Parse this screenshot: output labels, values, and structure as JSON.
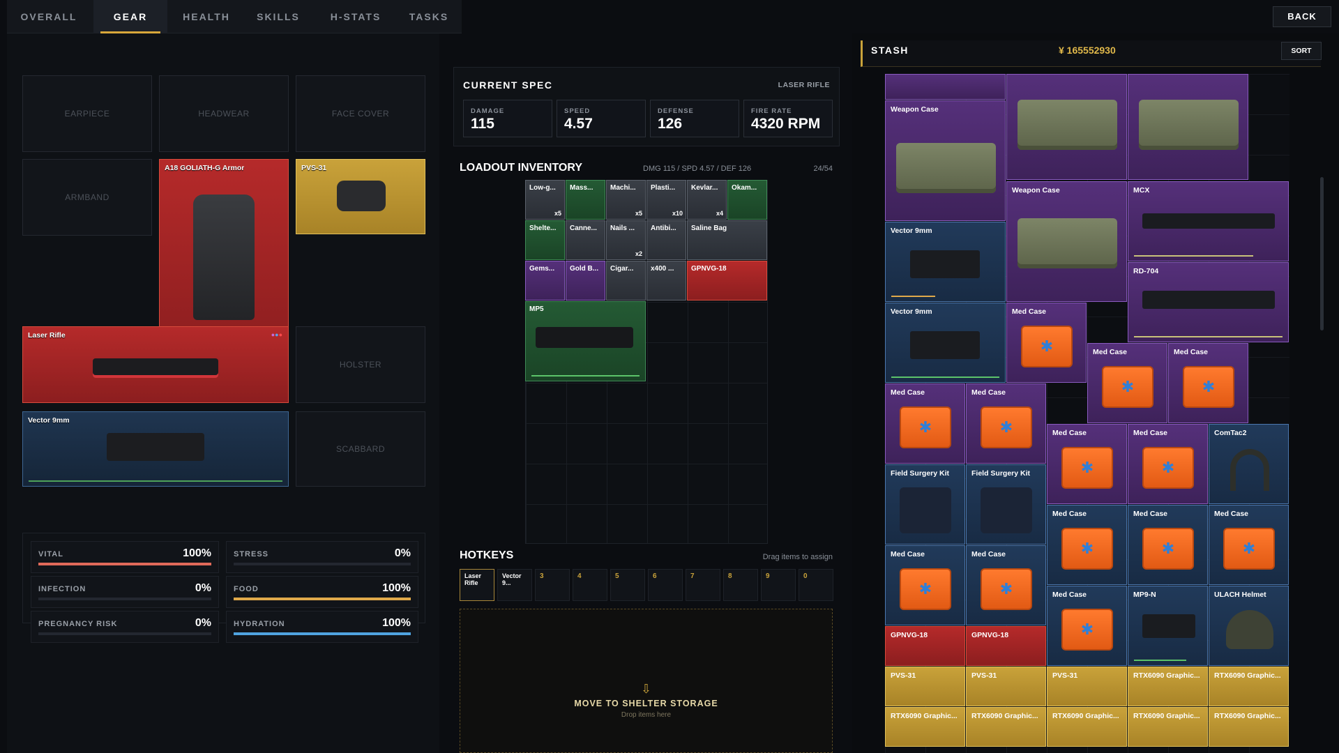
{
  "tabs": [
    "OVERALL",
    "GEAR",
    "HEALTH",
    "SKILLS",
    "H-STATS",
    "TASKS"
  ],
  "active_tab": "GEAR",
  "back_label": "BACK",
  "equipment": {
    "empty_slots": [
      "EARPIECE",
      "HEADWEAR",
      "FACE COVER",
      "ARMBAND",
      "HOLSTER",
      "SCABBARD"
    ],
    "armor": "A18 GOLIATH-G Armor",
    "nvg": "PVS-31",
    "primary": "Laser Rifle",
    "secondary": "Vector 9mm"
  },
  "vitals": [
    {
      "label": "VITAL",
      "value": "100%",
      "fill": 1.0,
      "color": "#e06a5a"
    },
    {
      "label": "STRESS",
      "value": "0%",
      "fill": 0,
      "color": "#8a9099"
    },
    {
      "label": "INFECTION",
      "value": "0%",
      "fill": 0,
      "color": "#6aa84f"
    },
    {
      "label": "FOOD",
      "value": "100%",
      "fill": 1.0,
      "color": "#e0a94a"
    },
    {
      "label": "PREGNANCY RISK",
      "value": "0%",
      "fill": 0,
      "color": "#c27ad1"
    },
    {
      "label": "HYDRATION",
      "value": "100%",
      "fill": 1.0,
      "color": "#4fa3e0"
    }
  ],
  "spec": {
    "title": "CURRENT SPEC",
    "weapon": "LASER RIFLE",
    "stats": [
      {
        "label": "DAMAGE",
        "value": "115"
      },
      {
        "label": "SPEED",
        "value": "4.57"
      },
      {
        "label": "DEFENSE",
        "value": "126"
      },
      {
        "label": "FIRE RATE",
        "value": "4320 RPM"
      }
    ]
  },
  "loadout": {
    "title": "LOADOUT INVENTORY",
    "summary": "DMG 115 / SPD 4.57 / DEF 126",
    "capacity": "24/54",
    "items": [
      {
        "name": "Low-g...",
        "count": "x5",
        "color": "grey"
      },
      {
        "name": "Mass...",
        "count": "",
        "color": "green"
      },
      {
        "name": "Machi...",
        "count": "x5",
        "color": "grey"
      },
      {
        "name": "Plasti...",
        "count": "x10",
        "color": "grey"
      },
      {
        "name": "Kevlar...",
        "count": "x4",
        "color": "grey"
      },
      {
        "name": "Okam...",
        "count": "",
        "color": "green"
      },
      {
        "name": "Shelte...",
        "count": "",
        "color": "green"
      },
      {
        "name": "Canne...",
        "count": "",
        "color": "grey"
      },
      {
        "name": "Nails ...",
        "count": "x2",
        "color": "grey"
      },
      {
        "name": "Antibi...",
        "count": "",
        "color": "grey"
      },
      {
        "name": "Saline Bag",
        "count": "",
        "color": "grey"
      },
      {
        "name": "Gems...",
        "count": "",
        "color": "purple"
      },
      {
        "name": "Gold B...",
        "count": "",
        "color": "purple"
      },
      {
        "name": "Cigar...",
        "count": "",
        "color": "grey"
      },
      {
        "name": "x400 ...",
        "count": "",
        "color": "grey"
      },
      {
        "name": "GPNVG-18",
        "count": "",
        "color": "red"
      },
      {
        "name": "MP5",
        "count": "",
        "color": "green"
      }
    ]
  },
  "hotkeys": {
    "title": "HOTKEYS",
    "hint": "Drag items to assign",
    "slots": [
      "Laser Rifle",
      "Vector 9...",
      "3",
      "4",
      "5",
      "6",
      "7",
      "8",
      "9",
      "0"
    ]
  },
  "drop": {
    "title": "MOVE TO SHELTER STORAGE",
    "sub": "Drop items here",
    "icon": "⇩"
  },
  "stash": {
    "title": "STASH",
    "money": "¥ 165552930",
    "sort": "SORT",
    "items": {
      "weapon_case": "Weapon Case",
      "mcx": "MCX",
      "vector": "Vector 9mm",
      "rd704": "RD-704",
      "med": "Med Case",
      "comtac": "ComTac2",
      "fsk": "Field Surgery Kit",
      "mp9": "MP9-N",
      "ulach": "ULACH Helmet",
      "gpnvg": "GPNVG-18",
      "pvs": "PVS-31",
      "rtx": "RTX6090 Graphic..."
    }
  }
}
